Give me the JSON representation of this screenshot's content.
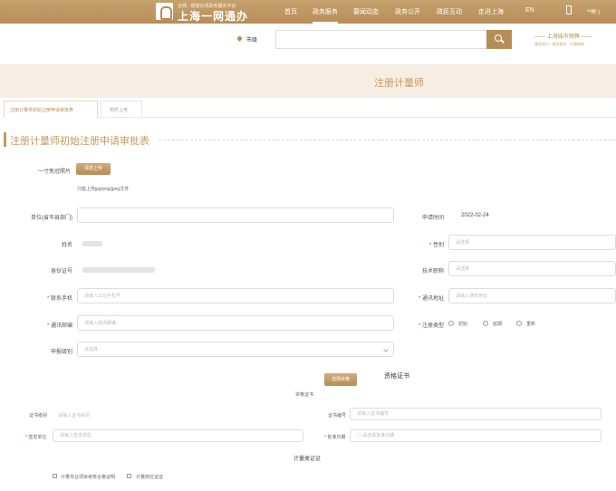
{
  "header": {
    "brand_sub": "全网 · 便捷在线政务服务平台",
    "brand_main": "上海一网通办",
    "nav": [
      "首页",
      "政务服务",
      "要闻动态",
      "政务公开",
      "政民互动",
      "走进上海",
      "EN"
    ],
    "user_text": "**彬 |"
  },
  "search": {
    "location": "市级",
    "placeholder": "",
    "region_title": "—— 上海城市频牌 ——",
    "region_links": "服务指引 · 政务服务 · 行政审批"
  },
  "page_title": "注册计量师",
  "tabs": [
    "注册计量师初始注册申请审批表",
    "附件上传"
  ],
  "section_title": "注册计量师初始注册申请审批表",
  "form": {
    "photo_label": "一寸免冠照片",
    "photo_button": "请选上传",
    "photo_hint": "只能上传jpg/png/jpeg文件",
    "unit_label": "单位(省市县部门)",
    "apply_time_label": "申请时间",
    "apply_time_value": "2022-02-24",
    "name_label": "姓名",
    "gender_label": "性别",
    "gender_placeholder": "请选择",
    "id_label": "身份证号",
    "title_label": "技术职称",
    "title_placeholder": "请选择",
    "phone_label": "联系手机",
    "phone_placeholder": "请输入11位手机号",
    "address_label": "通讯地址",
    "address_placeholder": "请输入通讯地址",
    "postcode_label": "通讯邮编",
    "postcode_placeholder": "请输入通讯邮编",
    "reg_type_label": "注册类型",
    "reg_types": [
      "初始",
      "延期",
      "重新"
    ],
    "level_label": "申报级别",
    "level_placeholder": "请选择",
    "cert_button": "选择资格",
    "cert_title": "资格证书",
    "cert_subtitle": "资格证书",
    "cert_level_label": "证书级别",
    "cert_level_placeholder": "请输入证书级别",
    "cert_no_label": "证书编号",
    "cert_no_placeholder": "请输入证书编号",
    "issuer_label": "签发单位",
    "issuer_placeholder": "请输入签发单位",
    "approve_date_label": "批准日期",
    "approve_date_placeholder": "请选择批准日期",
    "proof_title": "计量类证证",
    "checks": [
      "计量专业项目考核合格证明",
      "计量岗位证证"
    ]
  }
}
